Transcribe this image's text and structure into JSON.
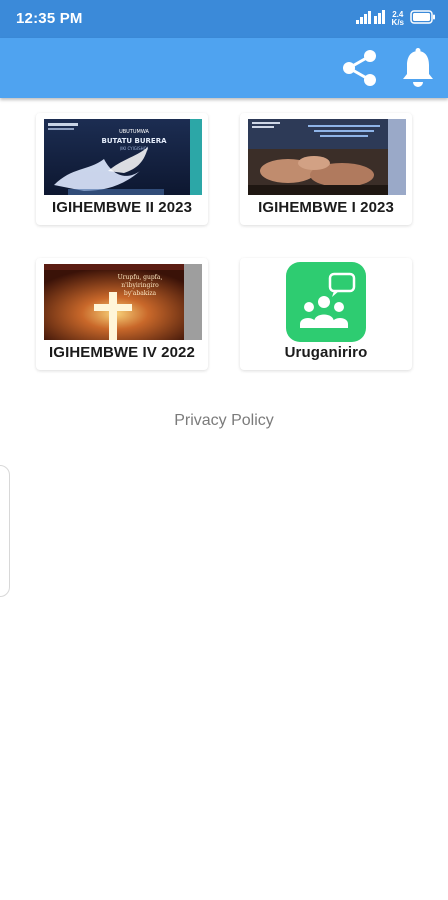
{
  "status_bar": {
    "time": "12:35 PM",
    "network_speed_value": "2.4",
    "network_speed_unit": "K/s",
    "icons": [
      "signal-icon",
      "wifi-icon",
      "battery-icon"
    ]
  },
  "app_bar": {
    "color": "#4fa3f0",
    "actions": [
      "share-icon",
      "notification-bell-icon"
    ]
  },
  "grid": {
    "items": [
      {
        "label": "IGIHEMBWE II 2023",
        "cover_title": "UBUTUMWA BUTATU BURERA"
      },
      {
        "label": "IGIHEMBWE I 2023",
        "cover_title": ""
      },
      {
        "label": "IGIHEMBWE IV 2022",
        "cover_title": "Urupfu, gupfa, n'ibyiringiro by'abakiza"
      },
      {
        "label": "Uruganiriro",
        "icon": "group-chat-icon",
        "icon_color": "#2ecc71"
      }
    ]
  },
  "footer": {
    "privacy_label": "Privacy Policy"
  }
}
